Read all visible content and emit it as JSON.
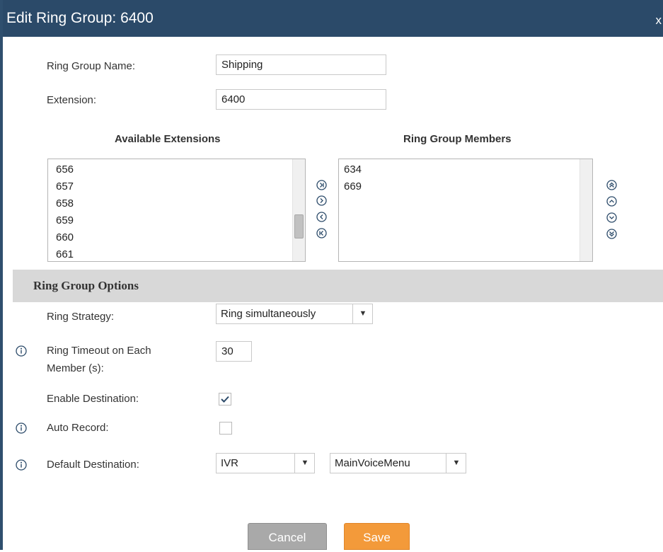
{
  "dialog": {
    "title": "Edit Ring Group: 6400",
    "close_label": "x"
  },
  "form": {
    "name_label": "Ring Group Name:",
    "name_value": "Shipping",
    "extension_label": "Extension:",
    "extension_value": "6400"
  },
  "available": {
    "header": "Available Extensions",
    "items": [
      "656",
      "657",
      "658",
      "659",
      "660",
      "661"
    ]
  },
  "members": {
    "header": "Ring Group Members",
    "items": [
      "634",
      "669"
    ]
  },
  "options": {
    "section_title": "Ring Group Options",
    "ring_strategy_label": "Ring Strategy:",
    "ring_strategy_value": "Ring simultaneously",
    "ring_timeout_label_line1": "Ring Timeout on Each",
    "ring_timeout_label_line2": "Member (s):",
    "ring_timeout_value": "30",
    "enable_destination_label": "Enable Destination:",
    "enable_destination_checked": true,
    "auto_record_label": "Auto Record:",
    "auto_record_checked": false,
    "default_destination_label": "Default Destination:",
    "default_destination_type": "IVR",
    "default_destination_target": "MainVoiceMenu"
  },
  "buttons": {
    "cancel": "Cancel",
    "save": "Save"
  },
  "colors": {
    "titlebar": "#2b4a69",
    "save": "#f39a3a",
    "cancel": "#a9a9a9",
    "section": "#d8d8d8",
    "icon": "#2b4a69"
  }
}
